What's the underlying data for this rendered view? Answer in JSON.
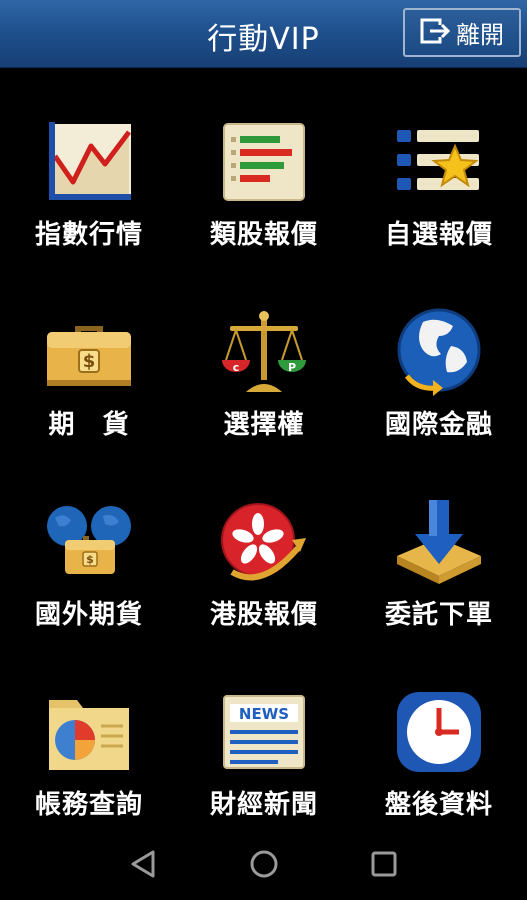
{
  "header": {
    "title": "行動VIP",
    "exit_label": "離開"
  },
  "tiles": [
    {
      "label": "指數行情",
      "icon": "line-chart-icon"
    },
    {
      "label": "類股報價",
      "icon": "bar-list-icon"
    },
    {
      "label": "自選報價",
      "icon": "favorite-list-icon"
    },
    {
      "label": "期　貨",
      "icon": "briefcase-dollar-icon"
    },
    {
      "label": "選擇權",
      "icon": "scale-icon"
    },
    {
      "label": "國際金融",
      "icon": "globe-icon"
    },
    {
      "label": "國外期貨",
      "icon": "globe-briefcase-icon"
    },
    {
      "label": "港股報價",
      "icon": "hk-flag-icon"
    },
    {
      "label": "委託下單",
      "icon": "download-arrow-icon"
    },
    {
      "label": "帳務查詢",
      "icon": "folder-pie-icon"
    },
    {
      "label": "財經新聞",
      "icon": "news-icon"
    },
    {
      "label": "盤後資料",
      "icon": "clock-icon"
    }
  ],
  "icon_labels": {
    "call": "c",
    "put": "P",
    "news": "NEWS",
    "currency": "$"
  },
  "navbar": [
    "back-icon",
    "home-icon",
    "recents-icon"
  ]
}
